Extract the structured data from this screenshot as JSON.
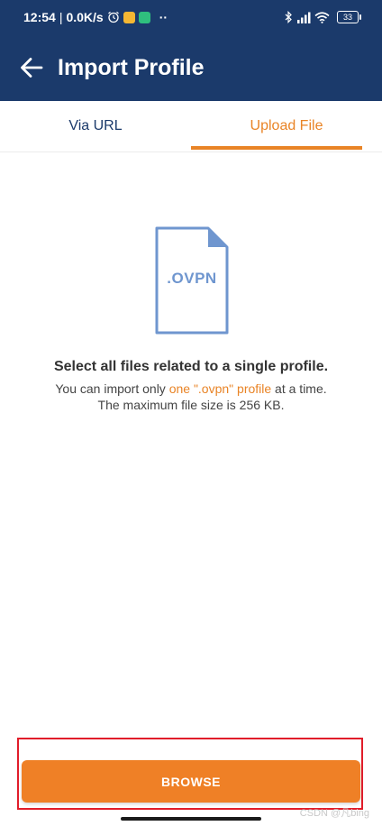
{
  "status_bar": {
    "time": "12:54",
    "separator": "|",
    "net_speed": "0.0K/s",
    "more": "··",
    "battery": "33",
    "icons": [
      "alarm-icon",
      "app-notification-icon",
      "shield-app-icon",
      "bluetooth-icon",
      "signal-icon",
      "wifi-icon",
      "battery-icon"
    ]
  },
  "app_bar": {
    "title": "Import Profile",
    "back_icon": "arrow-left-icon"
  },
  "tabs": [
    {
      "label": "Via URL",
      "active": false
    },
    {
      "label": "Upload File",
      "active": true
    }
  ],
  "file_illustration": {
    "extension": ".OVPN"
  },
  "description": {
    "title": "Select all files related to a single profile.",
    "line1_prefix": "You can import only ",
    "line1_highlight": "one \".ovpn\" profile",
    "line1_suffix": " at a time.",
    "line2": "The maximum file size is 256 KB."
  },
  "actions": {
    "browse_label": "BROWSE"
  },
  "watermark": "CSDN @凡bing",
  "colors": {
    "navy": "#1b3a6b",
    "accent_orange": "#e98426",
    "button_orange": "#ef8026",
    "file_blue": "#6f96cf",
    "annotation_red": "#e11d2a"
  }
}
